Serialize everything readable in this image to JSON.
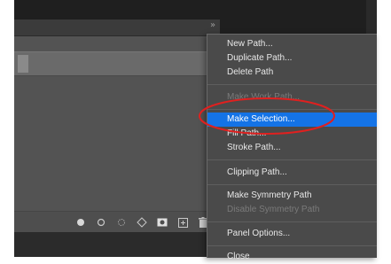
{
  "paths_panel": {
    "close_glyph": "»",
    "menu_glyph": "≡",
    "footer_icons": [
      {
        "name": "fill-path-icon"
      },
      {
        "name": "stroke-path-icon"
      },
      {
        "name": "load-selection-icon"
      },
      {
        "name": "make-work-path-icon"
      },
      {
        "name": "add-mask-icon"
      },
      {
        "name": "new-path-icon"
      },
      {
        "name": "delete-path-icon"
      }
    ]
  },
  "context_menu": {
    "items": [
      {
        "label": "New Path...",
        "enabled": true
      },
      {
        "label": "Duplicate Path...",
        "enabled": true
      },
      {
        "label": "Delete Path",
        "enabled": true
      },
      {
        "label": "Make Work Path...",
        "enabled": false
      },
      {
        "label": "Make Selection...",
        "enabled": true,
        "highlighted": true
      },
      {
        "label": "Fill Path...",
        "enabled": true
      },
      {
        "label": "Stroke Path...",
        "enabled": true
      },
      {
        "label": "Clipping Path...",
        "enabled": true
      },
      {
        "label": "Make Symmetry Path",
        "enabled": true
      },
      {
        "label": "Disable Symmetry Path",
        "enabled": false
      },
      {
        "label": "Panel Options...",
        "enabled": true
      },
      {
        "label": "Close",
        "enabled": true
      }
    ]
  },
  "colors": {
    "highlight": "#1473e6",
    "annotation": "#e0201f"
  }
}
